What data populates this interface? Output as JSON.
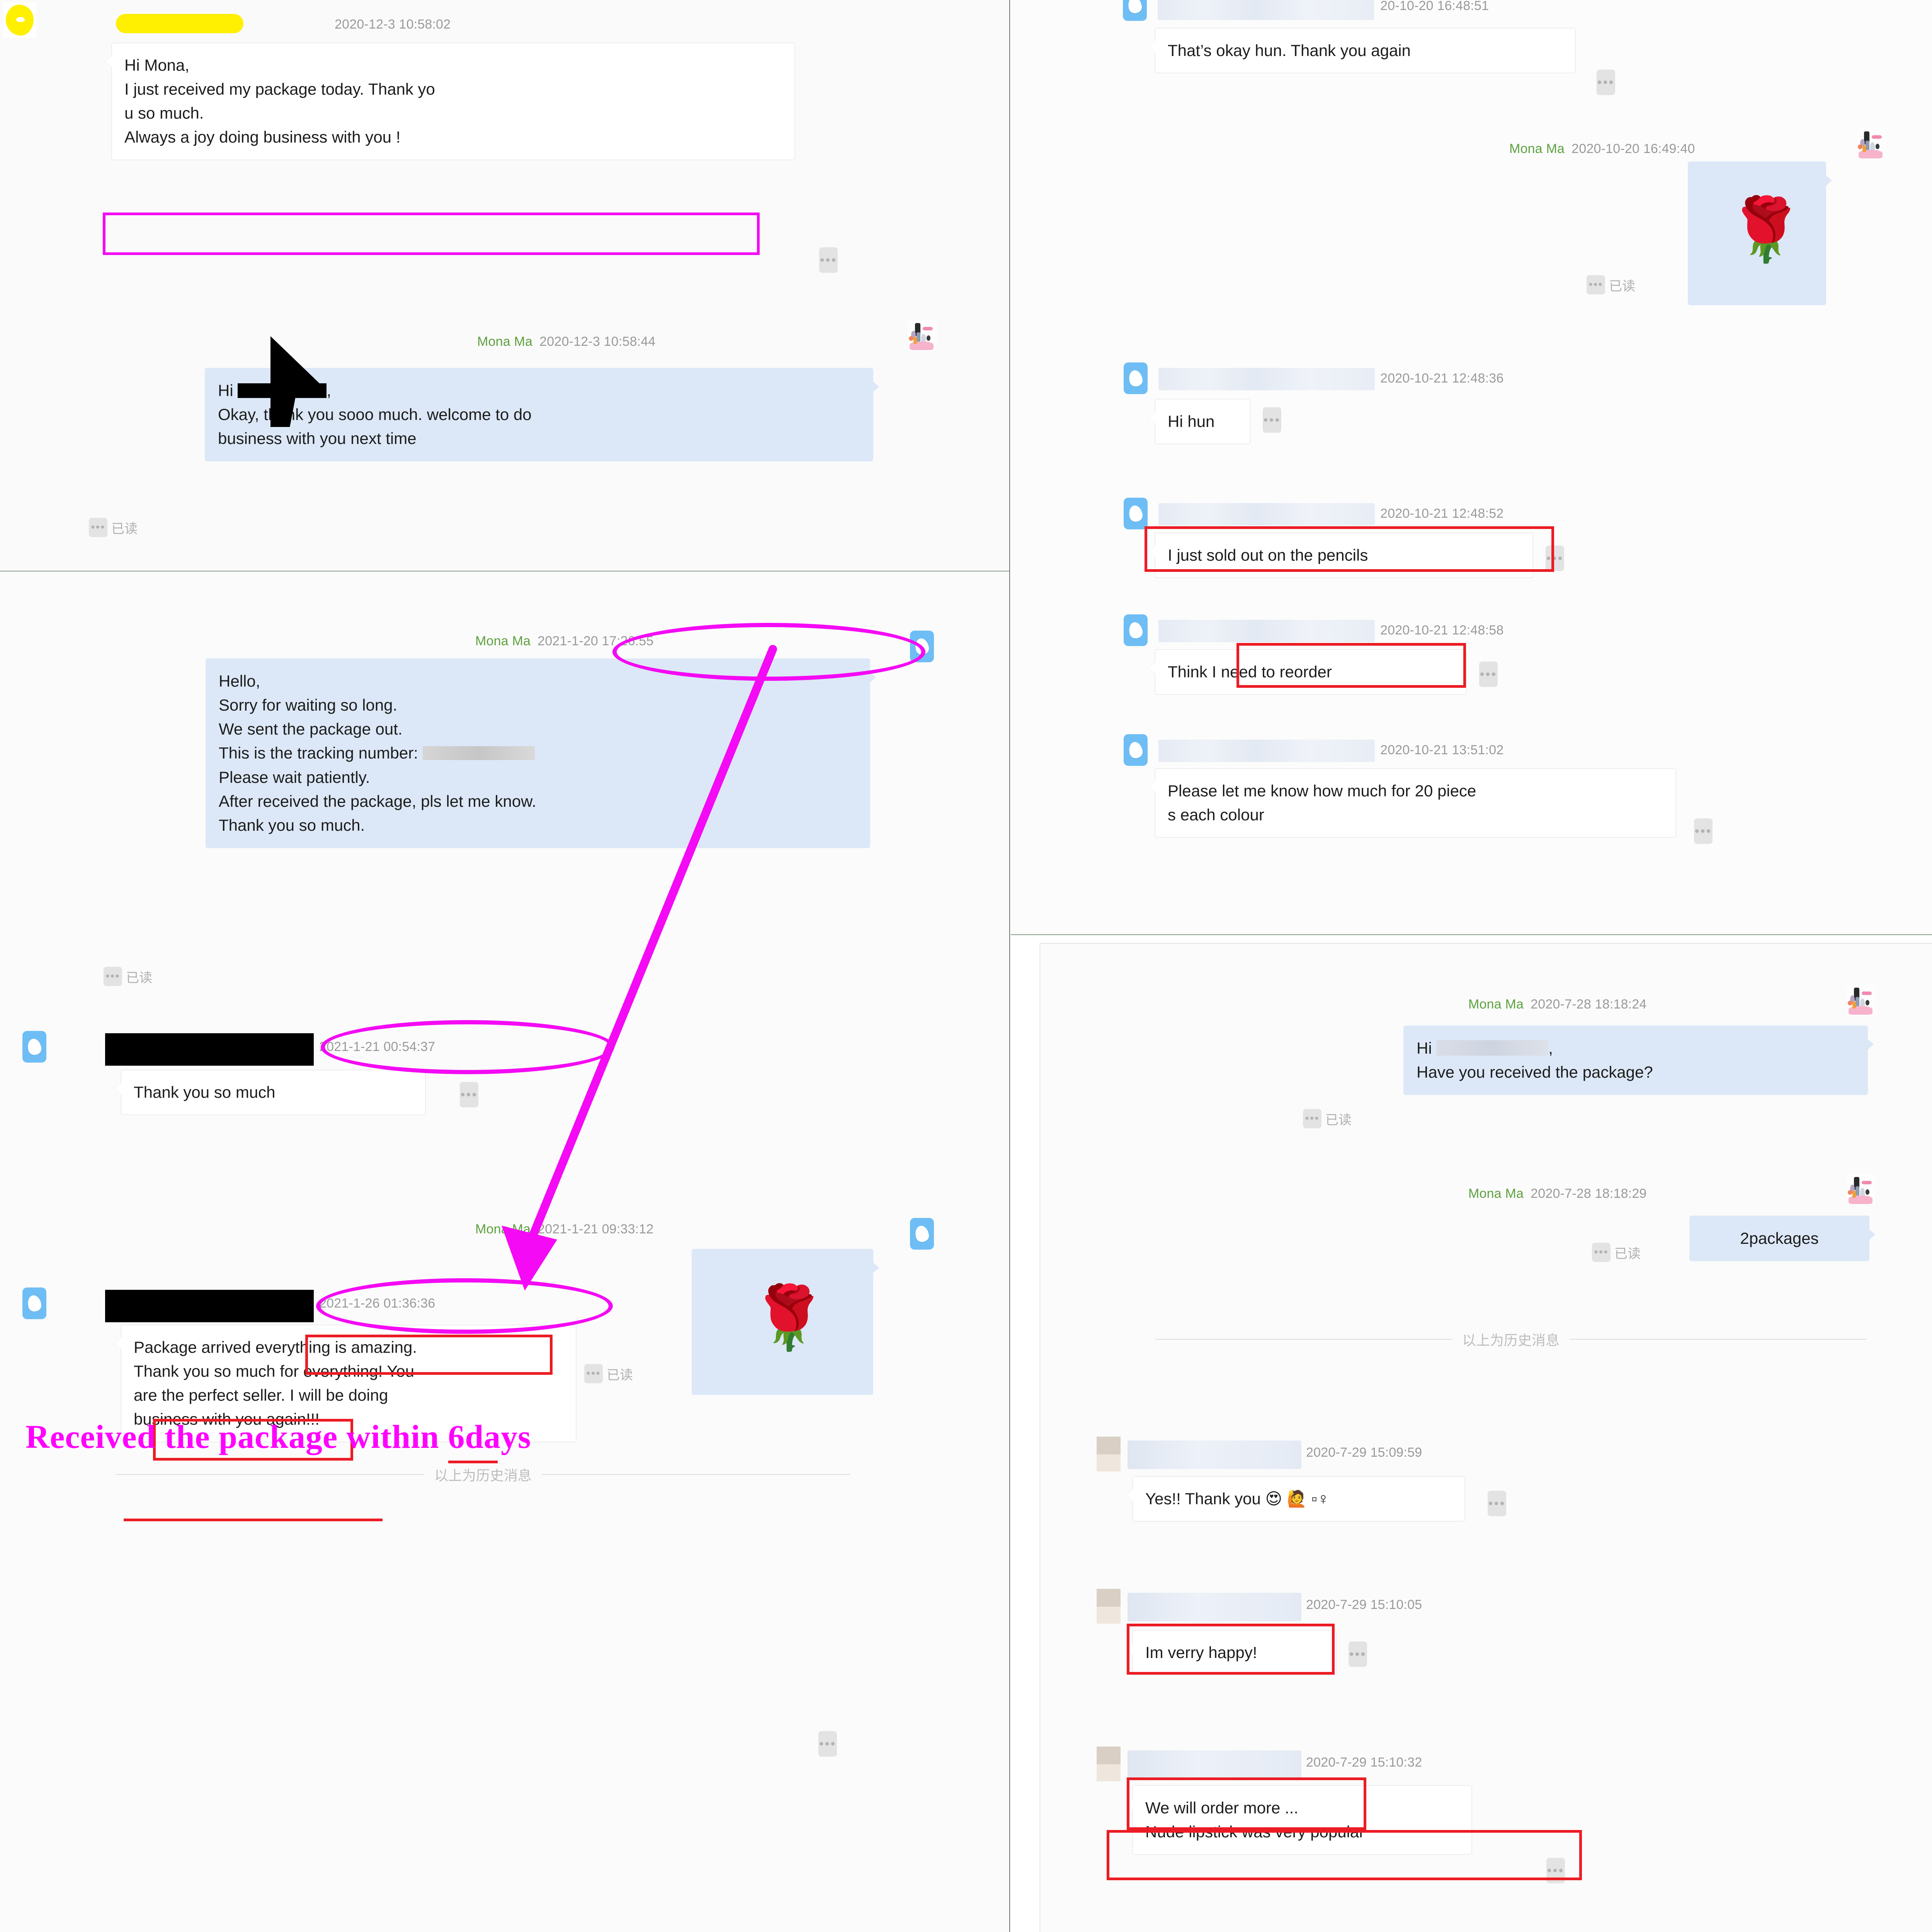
{
  "app": {
    "read_receipt_label": "已读",
    "history_divider_label": "以上为历史消息",
    "more_glyph": "•••",
    "rose_emoji": "🌹",
    "heart_eyes_emoji": "😍",
    "woman_raising_hand_emoji": "🙋",
    "accent_blue": "#6ebef5",
    "bubble_out_bg": "#dce8f7",
    "bubble_in_bg": "#ffffff",
    "name_color": "#5da13f",
    "time_color": "#9a9a9a",
    "annotation_magenta": "#f40af4",
    "annotation_red": "#ec1c24",
    "redaction_yellow": "#ffef00",
    "redaction_black": "#000000"
  },
  "panel_top_left": {
    "messages": [
      {
        "sender_name": "",
        "sender_redacted": true,
        "timestamp": "2020-12-3 10:58:02",
        "direction": "in",
        "text": "Hi Mona,\nI just received my package today. Thank yo\nu so much.\nAlways a joy doing business with you !"
      },
      {
        "sender_name": "Mona Ma",
        "timestamp": "2020-12-3 10:58:44",
        "direction": "out",
        "text": "Hi ██████,\nOkay, thank you sooo much. welcome to do\nbusiness with you next time",
        "read_status": "已读"
      }
    ],
    "annotations": [
      {
        "type": "box",
        "color": "#f40af4",
        "target": "Always a joy doing business with you !"
      },
      {
        "type": "black-arrow",
        "target": "Hi (redacted name)"
      }
    ]
  },
  "panel_bottom_left": {
    "messages": [
      {
        "sender_name": "Mona Ma",
        "timestamp": "2021-1-20 17:26:55",
        "direction": "out",
        "text": "Hello,\nSorry for waiting so long.\nWe sent the package out.\nThis is the tracking number:\nPlease wait patiently.\nAfter received the package, pls let me know.\nThank you so much.",
        "read_status": "已读",
        "tracking_number_redacted": true
      },
      {
        "sender_name": "",
        "sender_redacted": true,
        "timestamp": "2021-1-21 00:54:37",
        "direction": "in",
        "text": "Thank you so much"
      },
      {
        "sender_name": "Mona Ma",
        "timestamp": "2021-1-21 09:33:12",
        "direction": "out",
        "text": "🌹",
        "is_emoji_only": true,
        "read_status": "已读"
      },
      {
        "type": "history-divider",
        "label": "以上为历史消息"
      },
      {
        "sender_name": "",
        "sender_redacted": true,
        "timestamp": "2021-1-26 01:36:36",
        "direction": "in",
        "text": "Package arrived everything is amazing.\nThank you so much for everything! You\nare the perfect seller. I will be doing\nbusiness with you again!!!"
      }
    ],
    "annotations": [
      {
        "type": "ellipse",
        "color": "#f40af4",
        "target": "2021-1-20 17:26:55"
      },
      {
        "type": "ellipse",
        "color": "#f40af4",
        "target": "2021-1-21 00:54:37"
      },
      {
        "type": "ellipse",
        "color": "#f40af4",
        "target": "2021-1-26 01:36:36"
      },
      {
        "type": "arrow",
        "color": "#f40af4",
        "from": "2021-1-20 17:26:55",
        "to": "2021-1-26 01:36:36"
      },
      {
        "type": "box",
        "color": "#ec1c24",
        "target": "everything is amazing."
      },
      {
        "type": "box",
        "color": "#ec1c24",
        "target": "the perfect seller."
      },
      {
        "type": "underline",
        "color": "#ec1c24",
        "target": "doing"
      },
      {
        "type": "underline",
        "color": "#ec1c24",
        "target": "business with you again!!!"
      }
    ],
    "callout": "Received the package within 6days"
  },
  "panel_top_right": {
    "messages": [
      {
        "sender_name": "",
        "sender_redacted": true,
        "timestamp": "20-10-20 16:48:51",
        "timestamp_clipped": true,
        "direction": "in",
        "text": "That’s okay hun. Thank you again"
      },
      {
        "sender_name": "Mona Ma",
        "timestamp": "2020-10-20 16:49:40",
        "direction": "out",
        "text": "🌹",
        "is_emoji_only": true,
        "read_status": "已读"
      },
      {
        "sender_name": "",
        "sender_redacted": true,
        "timestamp": "2020-10-21 12:48:36",
        "direction": "in",
        "text": "Hi hun"
      },
      {
        "sender_name": "",
        "sender_redacted": true,
        "timestamp": "2020-10-21 12:48:52",
        "direction": "in",
        "text": "I just sold out on the pencils"
      },
      {
        "sender_name": "",
        "sender_redacted": true,
        "timestamp": "2020-10-21 12:48:58",
        "direction": "in",
        "text": "Think I need to reorder"
      },
      {
        "sender_name": "",
        "sender_redacted": true,
        "timestamp": "2020-10-21 13:51:02",
        "direction": "in",
        "text": "Please let me know how much for 20 piece\ns each colour"
      }
    ],
    "annotations": [
      {
        "type": "box",
        "color": "#ec1c24",
        "target": "I just sold out on the pencils"
      },
      {
        "type": "box",
        "color": "#ec1c24",
        "target": "need to reorder"
      }
    ]
  },
  "panel_bottom_right": {
    "messages": [
      {
        "sender_name": "Mona Ma",
        "timestamp": "2020-7-28 18:18:24",
        "direction": "out",
        "text": "Hi ██████,\nHave you received the package?",
        "read_status": "已读"
      },
      {
        "sender_name": "Mona Ma",
        "timestamp": "2020-7-28 18:18:29",
        "direction": "out",
        "text": "2packages",
        "read_status": "已读"
      },
      {
        "type": "history-divider",
        "label": "以上为历史消息"
      },
      {
        "sender_name": "",
        "sender_redacted": true,
        "timestamp": "2020-7-29 15:09:59",
        "direction": "in",
        "text": "Yes!! Thank you 😍 🙋 ▫♀"
      },
      {
        "sender_name": "",
        "sender_redacted": true,
        "timestamp": "2020-7-29 15:10:05",
        "direction": "in",
        "text": "Im verry happy!"
      },
      {
        "sender_name": "",
        "sender_redacted": true,
        "timestamp": "2020-7-29 15:10:32",
        "direction": "in",
        "text": "We will order more ...",
        "text2": "Nude lipstick was very popular"
      }
    ],
    "annotations": [
      {
        "type": "box",
        "color": "#ec1c24",
        "target": "Im verry happy!"
      },
      {
        "type": "box",
        "color": "#ec1c24",
        "target": "We will order more ..."
      },
      {
        "type": "box",
        "color": "#ec1c24",
        "target": "Nude lipstick was very popular"
      }
    ]
  }
}
